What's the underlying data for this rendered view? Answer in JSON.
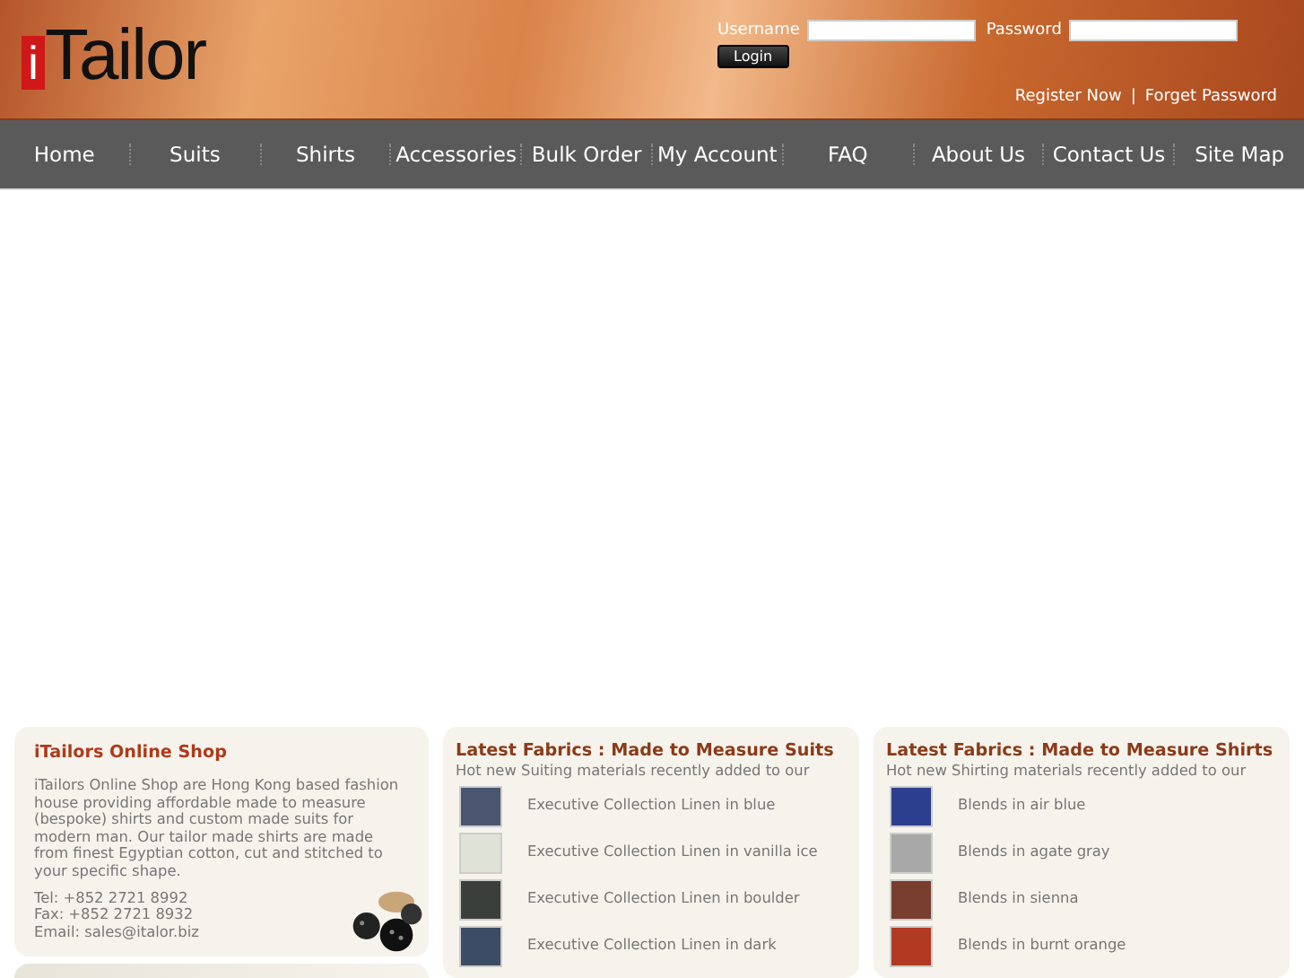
{
  "header": {
    "logo": {
      "mark": "i",
      "text": "Tailor"
    },
    "login": {
      "username_label": "Username",
      "password_label": "Password",
      "button": "Login"
    },
    "links": [
      "Register Now",
      "Forget Password"
    ],
    "separator": "|"
  },
  "nav": [
    "Home",
    "Suits",
    "Shirts",
    "Accessories",
    "Bulk Order",
    "My Account",
    "FAQ",
    "About Us",
    "Contact Us",
    "Site Map"
  ],
  "shop": {
    "title": "iTailors Online Shop",
    "description": "iTailors Online Shop are Hong Kong based fashion house providing affordable made to measure (bespoke) shirts and custom made suits for modern man. Our tailor made shirts are made from finest Egyptian cotton, cut and stitched to your specific shape.",
    "contacts": [
      "Tel: +852 2721 8992",
      "Fax: +852 2721 8932",
      "Email: sales@italor.biz"
    ]
  },
  "fabric_panels": [
    {
      "title": "Latest Fabrics : Made to Measure Suits",
      "subtitle": "Hot new Suiting materials recently added to our",
      "items": [
        {
          "name": "Executive Collection Linen in blue",
          "color": "#4a5670"
        },
        {
          "name": "Executive Collection Linen in vanilla ice",
          "color": "#dfe2d6"
        },
        {
          "name": "Executive Collection Linen in boulder",
          "color": "#3b3f3b"
        },
        {
          "name": "Executive Collection Linen in dark",
          "color": "#3d4c66"
        }
      ]
    },
    {
      "title": "Latest Fabrics : Made to Measure Shirts",
      "subtitle": "Hot new Shirting materials recently added to our",
      "items": [
        {
          "name": "Blends in air blue",
          "color": "#2b3f8e"
        },
        {
          "name": "Blends in agate gray",
          "color": "#a8a8a8"
        },
        {
          "name": "Blends in sienna",
          "color": "#7a3e2e"
        },
        {
          "name": "Blends in burnt orange",
          "color": "#b23a22"
        }
      ]
    }
  ]
}
